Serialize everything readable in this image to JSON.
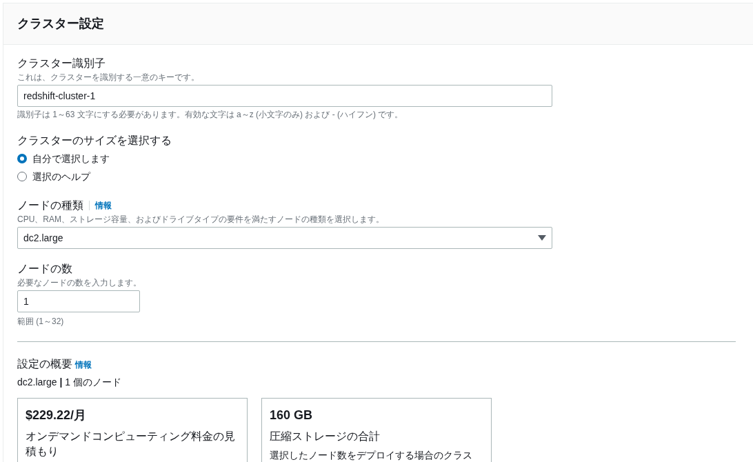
{
  "panel": {
    "title": "クラスター設定"
  },
  "identifier": {
    "label": "クラスター識別子",
    "description": "これは、クラスターを識別する一意のキーです。",
    "value": "redshift-cluster-1",
    "constraint": "識別子は 1～63 文字にする必要があります。有効な文字は a～z (小文字のみ) および - (ハイフン) です。"
  },
  "size": {
    "label": "クラスターのサイズを選択する",
    "options": [
      {
        "label": "自分で選択します",
        "selected": true
      },
      {
        "label": "選択のヘルプ",
        "selected": false
      }
    ]
  },
  "node_type": {
    "label": "ノードの種類",
    "info": "情報",
    "description": "CPU、RAM、ストレージ容量、およびドライブタイプの要件を満たすノードの種類を選択します。",
    "value": "dc2.large"
  },
  "node_count": {
    "label": "ノードの数",
    "description": "必要なノードの数を入力します。",
    "value": "1",
    "range": "範囲 (1～32)"
  },
  "summary": {
    "title": "設定の概要",
    "info": "情報",
    "line": "dc2.large **|** 1 個のノード",
    "cards": [
      {
        "value": "$229.22/月",
        "label": "オンデマンドコンピューティング料金の見積もり"
      },
      {
        "value": "160 GB",
        "label": "圧縮ストレージの合計",
        "description": "選択したノード数をデプロイする場合のクラス"
      }
    ]
  }
}
